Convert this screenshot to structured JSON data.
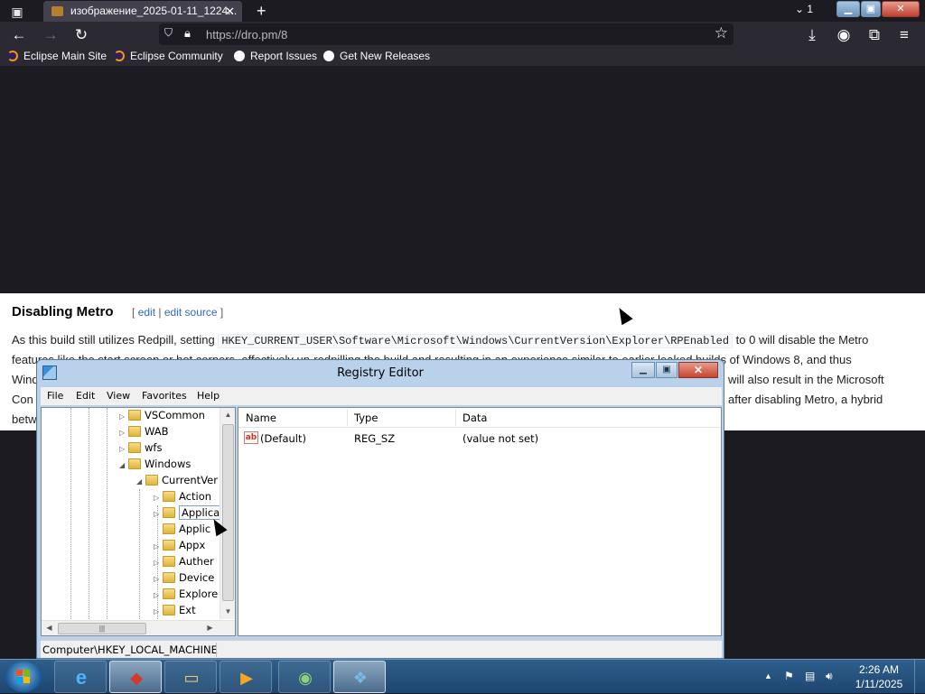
{
  "browser": {
    "tab_title": "изображение_2025-01-11_1224...",
    "tab_close": "✕",
    "new_tab": "+",
    "tab_count": "1",
    "url": "https://dro.pm/8",
    "bookmarks": [
      {
        "label": "Eclipse Main Site",
        "icon": "eclipse-icon"
      },
      {
        "label": "Eclipse Community",
        "icon": "eclipse-icon"
      },
      {
        "label": "Report Issues",
        "icon": "github-icon"
      },
      {
        "label": "Get New Releases",
        "icon": "github-icon"
      }
    ],
    "colors": {
      "toolbar": "#2b2a33",
      "background": "#1c1b22"
    }
  },
  "page": {
    "heading": "Disabling Metro",
    "edit_bracket_open": "[",
    "edit_link": "edit",
    "edit_divider": "|",
    "edit_source_link": "edit source",
    "edit_bracket_close": "]",
    "para_start": "As this build still utilizes Redpill, setting",
    "registry_path": "HKEY_CURRENT_USER\\Software\\Microsoft\\Windows\\CurrentVersion\\Explorer\\RPEnabled",
    "para_after_code": "to 0 will disable the Metro",
    "line2": "features like the start screen or hot corners, effectively un-redpilling the build and resulting in an experience similar to earlier leaked builds of Windows 8, and thus",
    "line3_left": "Wind",
    "line3_right": "will also result in the Microsoft",
    "line4_left": "Con",
    "line4_right": "after disabling Metro, a hybrid",
    "line5_left": "betw"
  },
  "registry_editor": {
    "title": "Registry Editor",
    "menu": [
      "File",
      "Edit",
      "View",
      "Favorites",
      "Help"
    ],
    "tree": [
      {
        "label": "VSCommon",
        "arrow": "▷",
        "level": 0
      },
      {
        "label": "WAB",
        "arrow": "▷",
        "level": 0
      },
      {
        "label": "wfs",
        "arrow": "▷",
        "level": 0
      },
      {
        "label": "Windows",
        "arrow": "◢",
        "level": 0
      },
      {
        "label": "CurrentVer",
        "arrow": "◢",
        "level": 1
      },
      {
        "label": "Action",
        "arrow": "▷",
        "level": 2
      },
      {
        "label": "Applica",
        "arrow": "▷",
        "level": 2,
        "selected": true
      },
      {
        "label": "Applic",
        "arrow": "",
        "level": 2
      },
      {
        "label": "Appx",
        "arrow": "▷",
        "level": 2
      },
      {
        "label": "Auther",
        "arrow": "▷",
        "level": 2
      },
      {
        "label": "Device",
        "arrow": "▷",
        "level": 2
      },
      {
        "label": "Explore",
        "arrow": "▷",
        "level": 2
      },
      {
        "label": "Ext",
        "arrow": "▷",
        "level": 2
      }
    ],
    "columns": [
      "Name",
      "Type",
      "Data"
    ],
    "values": [
      {
        "name": "(Default)",
        "type": "REG_SZ",
        "data": "(value not set)",
        "icon": "ab-string-icon"
      }
    ],
    "status_path": "Computer\\HKEY_LOCAL_MACHINE"
  },
  "taskbar": {
    "apps": [
      {
        "name": "internet-explorer",
        "glyph": "e"
      },
      {
        "name": "3d-app",
        "glyph": "◆"
      },
      {
        "name": "file-explorer",
        "glyph": "▭"
      },
      {
        "name": "media-player",
        "glyph": "▶"
      },
      {
        "name": "network-globe",
        "glyph": "◉"
      },
      {
        "name": "registry-editor",
        "glyph": "❖"
      }
    ],
    "time": "2:26 AM",
    "date": "1/11/2025",
    "tray_arrow": "▲",
    "colors": {
      "taskbar": "#1d4670"
    }
  }
}
